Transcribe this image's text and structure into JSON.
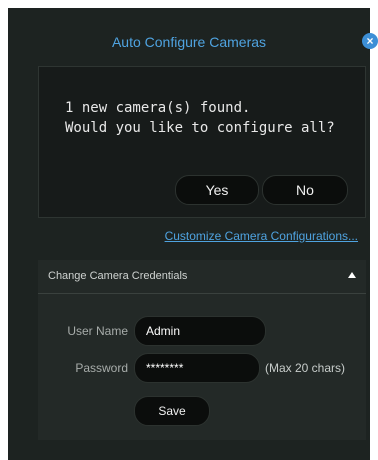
{
  "dialog": {
    "title": "Auto Configure Cameras",
    "close_icon": "close-icon",
    "message_line1": "1 new camera(s) found.",
    "message_line2": "Would you like to configure all?",
    "yes_label": "Yes",
    "no_label": "No",
    "customize_link": "Customize Camera Configurations..."
  },
  "credentials": {
    "title": "Change Camera Credentials",
    "collapse_icon": "chevron-up-icon",
    "username_label": "User Name",
    "username_value": "Admin",
    "password_label": "Password",
    "password_value": "********",
    "password_note": "(Max 20 chars)",
    "save_label": "Save"
  },
  "colors": {
    "accent": "#4fa3e0",
    "dialog_bg": "#1d2321",
    "button_bg": "#0b0d0c"
  }
}
